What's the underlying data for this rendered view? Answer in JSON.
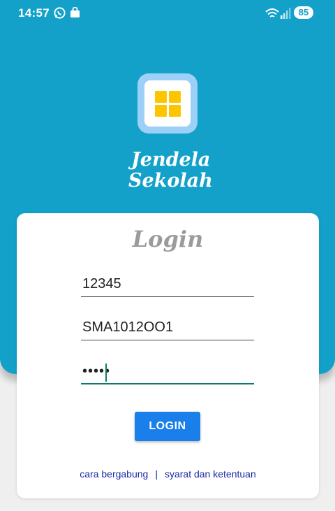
{
  "status_bar": {
    "time": "14:57",
    "battery": "85",
    "icons": [
      "whatsapp-icon",
      "shopping-bag-icon",
      "wifi-icon",
      "signal-icon"
    ]
  },
  "brand": {
    "line1": "Jendela",
    "line2": "Sekolah",
    "colors": {
      "primary": "#13a1c9",
      "logo_window": "#fdc500",
      "logo_frame": "#9dd0f7"
    }
  },
  "login": {
    "title": "Login",
    "fields": [
      {
        "name": "user-id",
        "value": "12345"
      },
      {
        "name": "school-code",
        "value": "SMA1012OO1"
      },
      {
        "name": "password",
        "value": "•••••",
        "masked": true
      }
    ],
    "button_label": "LOGIN",
    "button_color": "#1a7fea",
    "links": {
      "join": "cara bergabung",
      "separator": "|",
      "terms": "syarat dan ketentuan"
    }
  }
}
